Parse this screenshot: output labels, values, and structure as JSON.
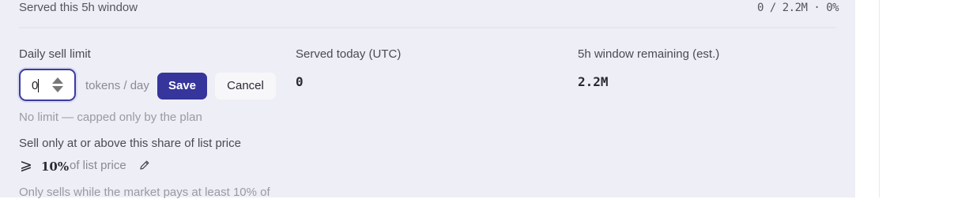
{
  "header": {
    "served_window_label": "Served this 5h window",
    "served_window_stats": "0 / 2.2M · 0%"
  },
  "limit": {
    "label": "Daily sell limit",
    "input_value": "0",
    "unit": "tokens / day",
    "save_label": "Save",
    "cancel_label": "Cancel",
    "hint": "No limit — capped only by the plan"
  },
  "served_today": {
    "label": "Served today (UTC)",
    "value": "0"
  },
  "window_remaining": {
    "label": "5h window remaining (est.)",
    "value": "2.2M"
  },
  "share": {
    "label": "Sell only at or above this share of list price",
    "symbol": "⩾",
    "value": "10%",
    "suffix": "of list price",
    "note": "Only sells while the market pays at least 10% of"
  },
  "icons": {
    "edit": "pencil-icon",
    "spinner": "stepper-arrows-icon"
  },
  "colors": {
    "accent": "#35359c",
    "panel_bg": "#eeeef6"
  }
}
